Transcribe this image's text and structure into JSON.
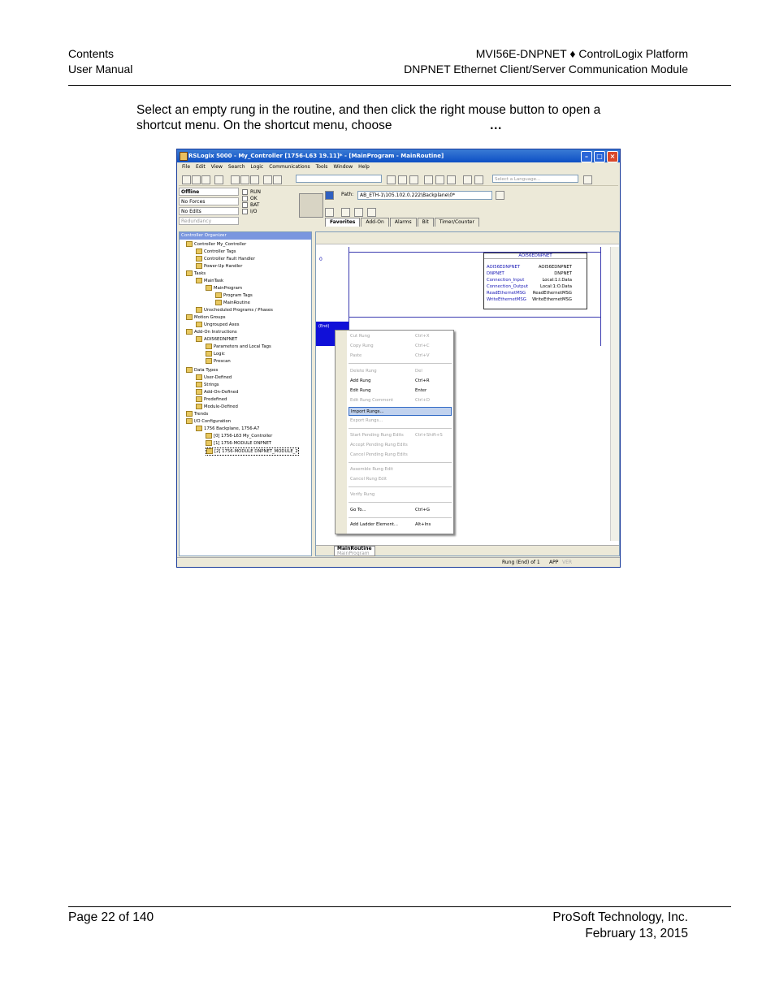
{
  "header": {
    "left_line1": "Contents",
    "left_line2": "User Manual",
    "right_line1": "MVI56E-DNPNET ♦ ControlLogix Platform",
    "right_line2": "DNPNET Ethernet Client/Server Communication Module"
  },
  "intro": {
    "line1": "Select an empty rung in the routine, and then click the right mouse button to open a",
    "line2": "shortcut menu. On the shortcut menu, choose",
    "line2_tail": "…"
  },
  "app": {
    "title": "RSLogix 5000 - My_Controller [1756-L63 19.11]* - [MainProgram - MainRoutine]",
    "menu": [
      "File",
      "Edit",
      "View",
      "Search",
      "Logic",
      "Communications",
      "Tools",
      "Window",
      "Help"
    ],
    "language_placeholder": "Select a Language...",
    "status": {
      "mode": "Offline",
      "forces": "No Forces",
      "edits": "No Edits",
      "redundancy": "Redundancy",
      "checks": [
        "RUN",
        "OK",
        "BAT",
        "I/O"
      ]
    },
    "path_label": "Path:",
    "path_value": "AB_ETH-1\\105.102.0.222\\Backplane\\0*",
    "tabs": [
      "Favorites",
      "Add-On",
      "Alarms",
      "Bit",
      "Timer/Counter"
    ],
    "organizer_title": "Controller Organizer",
    "tree": [
      "Controller My_Controller",
      "Controller Tags",
      "Controller Fault Handler",
      "Power-Up Handler",
      "Tasks",
      "MainTask",
      "MainProgram",
      "Program Tags",
      "MainRoutine",
      "Unscheduled Programs / Phases",
      "Motion Groups",
      "Ungrouped Axes",
      "Add-On Instructions",
      "AOI56EDNPNET",
      "Parameters and Local Tags",
      "Logic",
      "Prescan",
      "Data Types",
      "User-Defined",
      "Strings",
      "Add-On-Defined",
      "Predefined",
      "Module-Defined",
      "Trends",
      "I/O Configuration",
      "1756 Backplane, 1756-A7",
      "[0] 1756-L63 My_Controller",
      "[1] 1756-MODULE DNPNET",
      "[2] 1756-MODULE DNPNET_MODULE_2"
    ],
    "rung_number": "0",
    "end_label": "(End)",
    "aoi": {
      "title": "AOI56EDNPNET",
      "rows": [
        {
          "name": "AOI56EDNPNET",
          "value": "AOI56EDNPNET"
        },
        {
          "name": "DNPNET",
          "value": "DNPNET"
        },
        {
          "name": "Connection_Input",
          "value": "Local:1:I.Data"
        },
        {
          "name": "Connection_Output",
          "value": "Local:1:O.Data"
        },
        {
          "name": "ReadEthernetMSG",
          "value": "ReadEthernetMSG"
        },
        {
          "name": "WriteEthernetMSG",
          "value": "WriteEthernetMSG"
        }
      ]
    },
    "context_menu": [
      {
        "label": "Cut Rung",
        "key": "Ctrl+X",
        "state": "disabled"
      },
      {
        "label": "Copy Rung",
        "key": "Ctrl+C",
        "state": "disabled"
      },
      {
        "label": "Paste",
        "key": "Ctrl+V",
        "state": "disabled"
      },
      {
        "label": "Delete Rung",
        "key": "Del",
        "state": "disabled"
      },
      {
        "label": "Add Rung",
        "key": "Ctrl+R",
        "state": "enabled"
      },
      {
        "label": "Edit Rung",
        "key": "Enter",
        "state": "enabled"
      },
      {
        "label": "Edit Rung Comment",
        "key": "Ctrl+D",
        "state": "disabled"
      },
      {
        "label": "Import Rungs...",
        "key": "",
        "state": "selected"
      },
      {
        "label": "Export Rungs...",
        "key": "",
        "state": "disabled"
      },
      {
        "label": "Start Pending Rung Edits",
        "key": "Ctrl+Shift+S",
        "state": "disabled"
      },
      {
        "label": "Accept Pending Rung Edits",
        "key": "",
        "state": "disabled"
      },
      {
        "label": "Cancel Pending Rung Edits",
        "key": "",
        "state": "disabled"
      },
      {
        "label": "Assemble Rung Edit",
        "key": "",
        "state": "disabled"
      },
      {
        "label": "Cancel Rung Edit",
        "key": "",
        "state": "disabled"
      },
      {
        "label": "Verify Rung",
        "key": "",
        "state": "disabled"
      },
      {
        "label": "Go To...",
        "key": "Ctrl+G",
        "state": "enabled"
      },
      {
        "label": "Add Ladder Element...",
        "key": "Alt+Ins",
        "state": "enabled"
      }
    ],
    "routine_tab": "MainRoutine",
    "routine_tab_sub": "MainProgram",
    "status_bar": {
      "rung": "Rung (End) of 1",
      "app": "APP",
      "ver": "VER"
    }
  },
  "footer": {
    "left": "Page 22 of 140",
    "right_line1": "ProSoft Technology, Inc.",
    "right_line2": "February 13, 2015"
  }
}
